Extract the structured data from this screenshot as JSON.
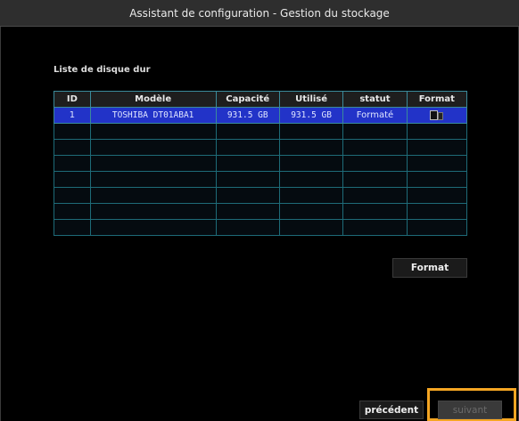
{
  "window": {
    "title": "Assistant de configuration - Gestion du stockage"
  },
  "section": {
    "label": "Liste de disque dur"
  },
  "table": {
    "headers": [
      "ID",
      "Modèle",
      "Capacité",
      "Utilisé",
      "statut",
      "Format"
    ],
    "rows": [
      {
        "id": "1",
        "model": "TOSHIBA DT01ABA1",
        "capacity": "931.5 GB",
        "used": "931.5 GB",
        "status": "Formaté",
        "format_icon": "drive-format-icon"
      }
    ],
    "empty_row_count": 7
  },
  "buttons": {
    "format": "Format",
    "previous": "précédent",
    "next": "suivant"
  },
  "colors": {
    "selected_row": "#2233c8",
    "grid_line": "#1e6b78",
    "highlight": "#f5a623"
  }
}
